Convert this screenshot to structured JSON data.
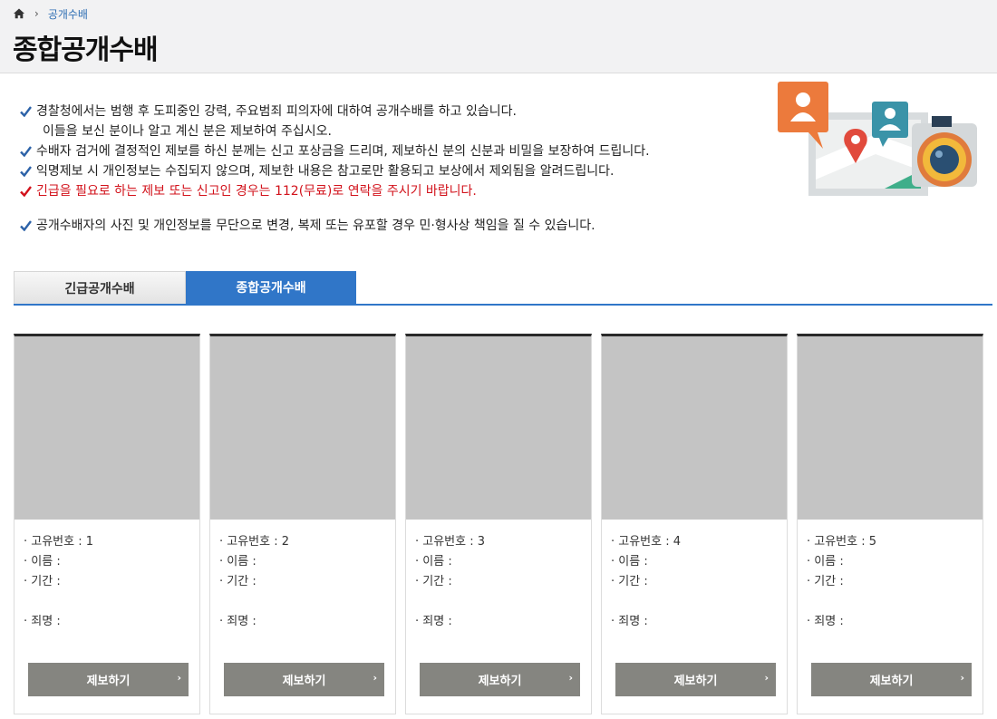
{
  "breadcrumb": {
    "home_icon": "home-icon",
    "current": "공개수배"
  },
  "page": {
    "title": "종합공개수배"
  },
  "notice": {
    "line1": "경찰청에서는 범행 후 도피중인 강력, 주요범죄 피의자에 대하여 공개수배를 하고 있습니다.",
    "line1b": "이들을 보신 분이나 알고 계신 분은 제보하여 주십시오.",
    "line2": "수배자 검거에 결정적인 제보를 하신 분께는 신고 포상금을 드리며, 제보하신 분의 신분과 비밀을 보장하여 드립니다.",
    "line3": "익명제보 시 개인정보는 수집되지 않으며, 제보한 내용은 참고로만 활용되고 보상에서 제외됨을 알려드립니다.",
    "line4": "긴급을 필요로 하는 제보 또는 신고인 경우는 112(무료)로 연락을 주시기 바랍니다.",
    "line5": "공개수배자의 사진 및 개인정보를 무단으로 변경, 복제 또는 유포할 경우 민·형사상 책임을 질 수 있습니다."
  },
  "colors": {
    "accent": "#3076c8",
    "urgent": "#d2121b",
    "button": "#858580",
    "photo_placeholder": "#c4c4c4"
  },
  "tabs": [
    {
      "label": "긴급공개수배",
      "active": false
    },
    {
      "label": "종합공개수배",
      "active": true
    }
  ],
  "cards": [
    {
      "id_label": "· 고유번호 : 1",
      "name_label": "· 이름 :",
      "period_label": "· 기간 :",
      "crime_label": "· 죄명 :",
      "button": "제보하기"
    },
    {
      "id_label": "· 고유번호 : 2",
      "name_label": "· 이름 :",
      "period_label": "· 기간 :",
      "crime_label": "· 죄명 :",
      "button": "제보하기"
    },
    {
      "id_label": "· 고유번호 : 3",
      "name_label": "· 이름 :",
      "period_label": "· 기간 :",
      "crime_label": "· 죄명 :",
      "button": "제보하기"
    },
    {
      "id_label": "· 고유번호 : 4",
      "name_label": "· 이름 :",
      "period_label": "· 기간 :",
      "crime_label": "· 죄명 :",
      "button": "제보하기"
    },
    {
      "id_label": "· 고유번호 : 5",
      "name_label": "· 이름 :",
      "period_label": "· 기간 :",
      "crime_label": "· 죄명 :",
      "button": "제보하기"
    }
  ]
}
